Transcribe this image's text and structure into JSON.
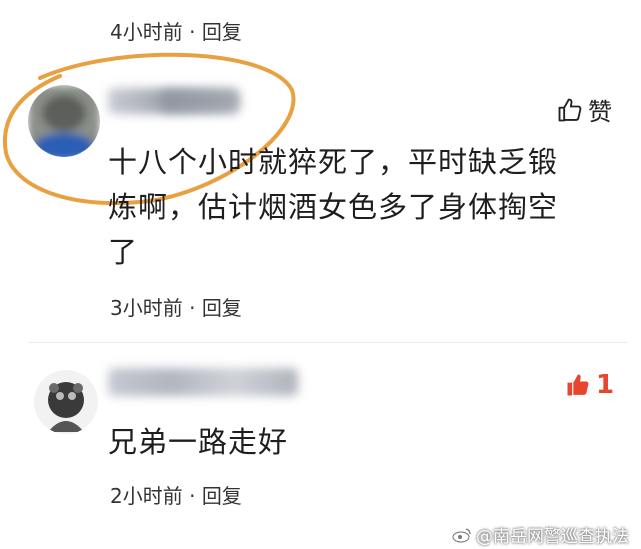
{
  "colors": {
    "highlight_circle": "#e8a040",
    "like_red": "#e8452f",
    "text": "#1e1e1e",
    "meta": "#333333"
  },
  "top_meta": {
    "time": "4小时前",
    "separator": "·",
    "reply": "回复"
  },
  "comments": [
    {
      "author": "",
      "text_lines": [
        "十八个小时就猝死了，平时缺乏锻",
        "炼啊，估计烟酒女色多了身体掏空",
        "了"
      ],
      "time": "3小时前",
      "separator": "·",
      "reply": "回复",
      "like_label": "赞",
      "like_icon": "thumbs-up-outline-icon"
    },
    {
      "author": "",
      "text_lines": [
        "兄弟一路走好"
      ],
      "time": "2小时前",
      "separator": "·",
      "reply": "回复",
      "like_count": "1",
      "like_icon": "thumbs-up-filled-red-icon"
    }
  ],
  "watermark": {
    "icon": "weibo-icon",
    "text": "@南岳网警巡查执法"
  }
}
